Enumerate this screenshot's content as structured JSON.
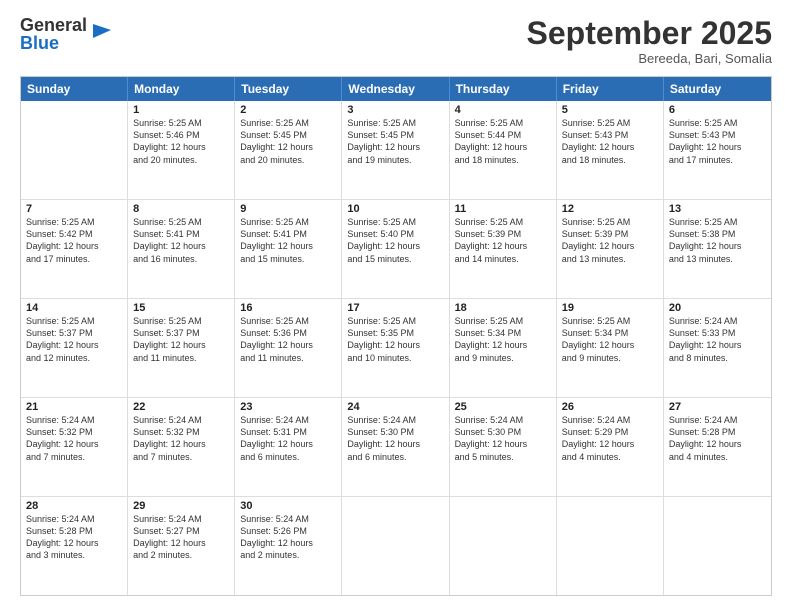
{
  "logo": {
    "general": "General",
    "blue": "Blue"
  },
  "title": "September 2025",
  "location": "Bereeda, Bari, Somalia",
  "days_of_week": [
    "Sunday",
    "Monday",
    "Tuesday",
    "Wednesday",
    "Thursday",
    "Friday",
    "Saturday"
  ],
  "weeks": [
    [
      {
        "day": "",
        "info": ""
      },
      {
        "day": "1",
        "info": "Sunrise: 5:25 AM\nSunset: 5:46 PM\nDaylight: 12 hours\nand 20 minutes."
      },
      {
        "day": "2",
        "info": "Sunrise: 5:25 AM\nSunset: 5:45 PM\nDaylight: 12 hours\nand 20 minutes."
      },
      {
        "day": "3",
        "info": "Sunrise: 5:25 AM\nSunset: 5:45 PM\nDaylight: 12 hours\nand 19 minutes."
      },
      {
        "day": "4",
        "info": "Sunrise: 5:25 AM\nSunset: 5:44 PM\nDaylight: 12 hours\nand 18 minutes."
      },
      {
        "day": "5",
        "info": "Sunrise: 5:25 AM\nSunset: 5:43 PM\nDaylight: 12 hours\nand 18 minutes."
      },
      {
        "day": "6",
        "info": "Sunrise: 5:25 AM\nSunset: 5:43 PM\nDaylight: 12 hours\nand 17 minutes."
      }
    ],
    [
      {
        "day": "7",
        "info": "Sunrise: 5:25 AM\nSunset: 5:42 PM\nDaylight: 12 hours\nand 17 minutes."
      },
      {
        "day": "8",
        "info": "Sunrise: 5:25 AM\nSunset: 5:41 PM\nDaylight: 12 hours\nand 16 minutes."
      },
      {
        "day": "9",
        "info": "Sunrise: 5:25 AM\nSunset: 5:41 PM\nDaylight: 12 hours\nand 15 minutes."
      },
      {
        "day": "10",
        "info": "Sunrise: 5:25 AM\nSunset: 5:40 PM\nDaylight: 12 hours\nand 15 minutes."
      },
      {
        "day": "11",
        "info": "Sunrise: 5:25 AM\nSunset: 5:39 PM\nDaylight: 12 hours\nand 14 minutes."
      },
      {
        "day": "12",
        "info": "Sunrise: 5:25 AM\nSunset: 5:39 PM\nDaylight: 12 hours\nand 13 minutes."
      },
      {
        "day": "13",
        "info": "Sunrise: 5:25 AM\nSunset: 5:38 PM\nDaylight: 12 hours\nand 13 minutes."
      }
    ],
    [
      {
        "day": "14",
        "info": "Sunrise: 5:25 AM\nSunset: 5:37 PM\nDaylight: 12 hours\nand 12 minutes."
      },
      {
        "day": "15",
        "info": "Sunrise: 5:25 AM\nSunset: 5:37 PM\nDaylight: 12 hours\nand 11 minutes."
      },
      {
        "day": "16",
        "info": "Sunrise: 5:25 AM\nSunset: 5:36 PM\nDaylight: 12 hours\nand 11 minutes."
      },
      {
        "day": "17",
        "info": "Sunrise: 5:25 AM\nSunset: 5:35 PM\nDaylight: 12 hours\nand 10 minutes."
      },
      {
        "day": "18",
        "info": "Sunrise: 5:25 AM\nSunset: 5:34 PM\nDaylight: 12 hours\nand 9 minutes."
      },
      {
        "day": "19",
        "info": "Sunrise: 5:25 AM\nSunset: 5:34 PM\nDaylight: 12 hours\nand 9 minutes."
      },
      {
        "day": "20",
        "info": "Sunrise: 5:24 AM\nSunset: 5:33 PM\nDaylight: 12 hours\nand 8 minutes."
      }
    ],
    [
      {
        "day": "21",
        "info": "Sunrise: 5:24 AM\nSunset: 5:32 PM\nDaylight: 12 hours\nand 7 minutes."
      },
      {
        "day": "22",
        "info": "Sunrise: 5:24 AM\nSunset: 5:32 PM\nDaylight: 12 hours\nand 7 minutes."
      },
      {
        "day": "23",
        "info": "Sunrise: 5:24 AM\nSunset: 5:31 PM\nDaylight: 12 hours\nand 6 minutes."
      },
      {
        "day": "24",
        "info": "Sunrise: 5:24 AM\nSunset: 5:30 PM\nDaylight: 12 hours\nand 6 minutes."
      },
      {
        "day": "25",
        "info": "Sunrise: 5:24 AM\nSunset: 5:30 PM\nDaylight: 12 hours\nand 5 minutes."
      },
      {
        "day": "26",
        "info": "Sunrise: 5:24 AM\nSunset: 5:29 PM\nDaylight: 12 hours\nand 4 minutes."
      },
      {
        "day": "27",
        "info": "Sunrise: 5:24 AM\nSunset: 5:28 PM\nDaylight: 12 hours\nand 4 minutes."
      }
    ],
    [
      {
        "day": "28",
        "info": "Sunrise: 5:24 AM\nSunset: 5:28 PM\nDaylight: 12 hours\nand 3 minutes."
      },
      {
        "day": "29",
        "info": "Sunrise: 5:24 AM\nSunset: 5:27 PM\nDaylight: 12 hours\nand 2 minutes."
      },
      {
        "day": "30",
        "info": "Sunrise: 5:24 AM\nSunset: 5:26 PM\nDaylight: 12 hours\nand 2 minutes."
      },
      {
        "day": "",
        "info": ""
      },
      {
        "day": "",
        "info": ""
      },
      {
        "day": "",
        "info": ""
      },
      {
        "day": "",
        "info": ""
      }
    ]
  ]
}
